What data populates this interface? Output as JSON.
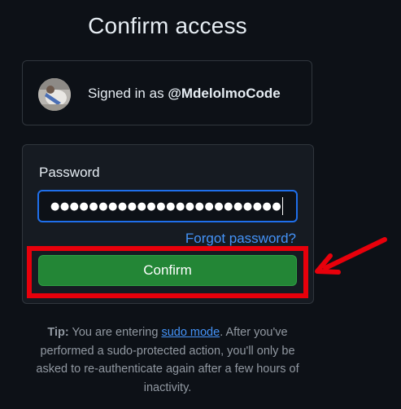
{
  "page": {
    "title": "Confirm access"
  },
  "account": {
    "signed_in_prefix": "Signed in as",
    "username": "@MdelolmoCode"
  },
  "form": {
    "password_label": "Password",
    "password_value": "●●●●●●●●●●●●●●●●●●●●●●●●",
    "forgot_password": "Forgot password?",
    "confirm_label": "Confirm"
  },
  "tip": {
    "label": "Tip:",
    "text_before_link": "You are entering",
    "link_text": "sudo mode",
    "text_after_link": ". After you've performed a sudo-protected action, you'll only be asked to re-authenticate again after a few hours of inactivity."
  },
  "annotation": {
    "highlight_color": "#e8000b"
  },
  "colors": {
    "background": "#0d1117",
    "panel": "#161b22",
    "border": "#30363d",
    "primary_button": "#238636",
    "link": "#4493f8",
    "focus": "#1f6feb"
  }
}
